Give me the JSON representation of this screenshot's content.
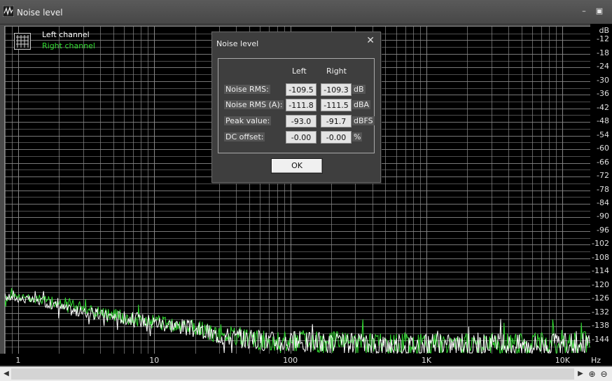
{
  "window": {
    "title": "Noise level"
  },
  "legend": {
    "left": "Left channel",
    "right": "Right channel"
  },
  "colors": {
    "left": "#ffffff",
    "right": "#33dd33",
    "grid": "#8c8c8c",
    "background": "#000000"
  },
  "y_axis": {
    "unit": "dB",
    "ticks": [
      "-12",
      "-18",
      "-24",
      "-30",
      "-36",
      "-42",
      "-48",
      "-54",
      "-60",
      "-66",
      "-72",
      "-78",
      "-84",
      "-90",
      "-96",
      "-102",
      "-108",
      "-114",
      "-120",
      "-126",
      "-132",
      "-138",
      "-144"
    ]
  },
  "x_axis": {
    "unit": "Hz",
    "ticks": [
      "1",
      "10",
      "100",
      "1K",
      "10K"
    ]
  },
  "dialog": {
    "title": "Noise level",
    "columns": {
      "left": "Left",
      "right": "Right"
    },
    "rows": [
      {
        "label": "Noise RMS:",
        "left": "-109.5",
        "right": "-109.3",
        "unit": "dB"
      },
      {
        "label": "Noise RMS (A):",
        "left": "-111.8",
        "right": "-111.5",
        "unit": "dBA"
      },
      {
        "label": "Peak value:",
        "left": "-93.0",
        "right": "-91.7",
        "unit": "dBFS"
      },
      {
        "label": "DC offset:",
        "left": "-0.00",
        "right": "-0.00",
        "unit": "%"
      }
    ],
    "ok_label": "OK"
  },
  "chart_data": {
    "type": "line",
    "xscale": "log",
    "xlim": [
      0.8,
      16000
    ],
    "ylim": [
      -150,
      -6
    ],
    "ylabel": "dB",
    "xlabel": "Hz",
    "grid": true,
    "legend": "top-left",
    "series": [
      {
        "name": "Left channel",
        "x": [
          0.8,
          1.5,
          2.5,
          4,
          6,
          10,
          16,
          25,
          40,
          60,
          100,
          160,
          250,
          400,
          600,
          1000,
          1600,
          2500,
          4000,
          6000,
          10000,
          16000
        ],
        "y": [
          -125,
          -127,
          -131,
          -133,
          -134,
          -136,
          -138,
          -141,
          -143,
          -144,
          -145,
          -145,
          -146,
          -146,
          -146,
          -146,
          -146,
          -146,
          -146,
          -146,
          -146,
          -145
        ]
      },
      {
        "name": "Right channel",
        "x": [
          0.8,
          1.5,
          2.5,
          4,
          6,
          10,
          16,
          25,
          40,
          60,
          100,
          160,
          250,
          400,
          600,
          1000,
          1600,
          2500,
          4000,
          6000,
          10000,
          16000
        ],
        "y": [
          -125,
          -126,
          -129,
          -131,
          -134,
          -136,
          -138,
          -140,
          -142,
          -144,
          -144,
          -145,
          -145,
          -146,
          -146,
          -146,
          -146,
          -146,
          -146,
          -146,
          -146,
          -145
        ]
      }
    ]
  }
}
